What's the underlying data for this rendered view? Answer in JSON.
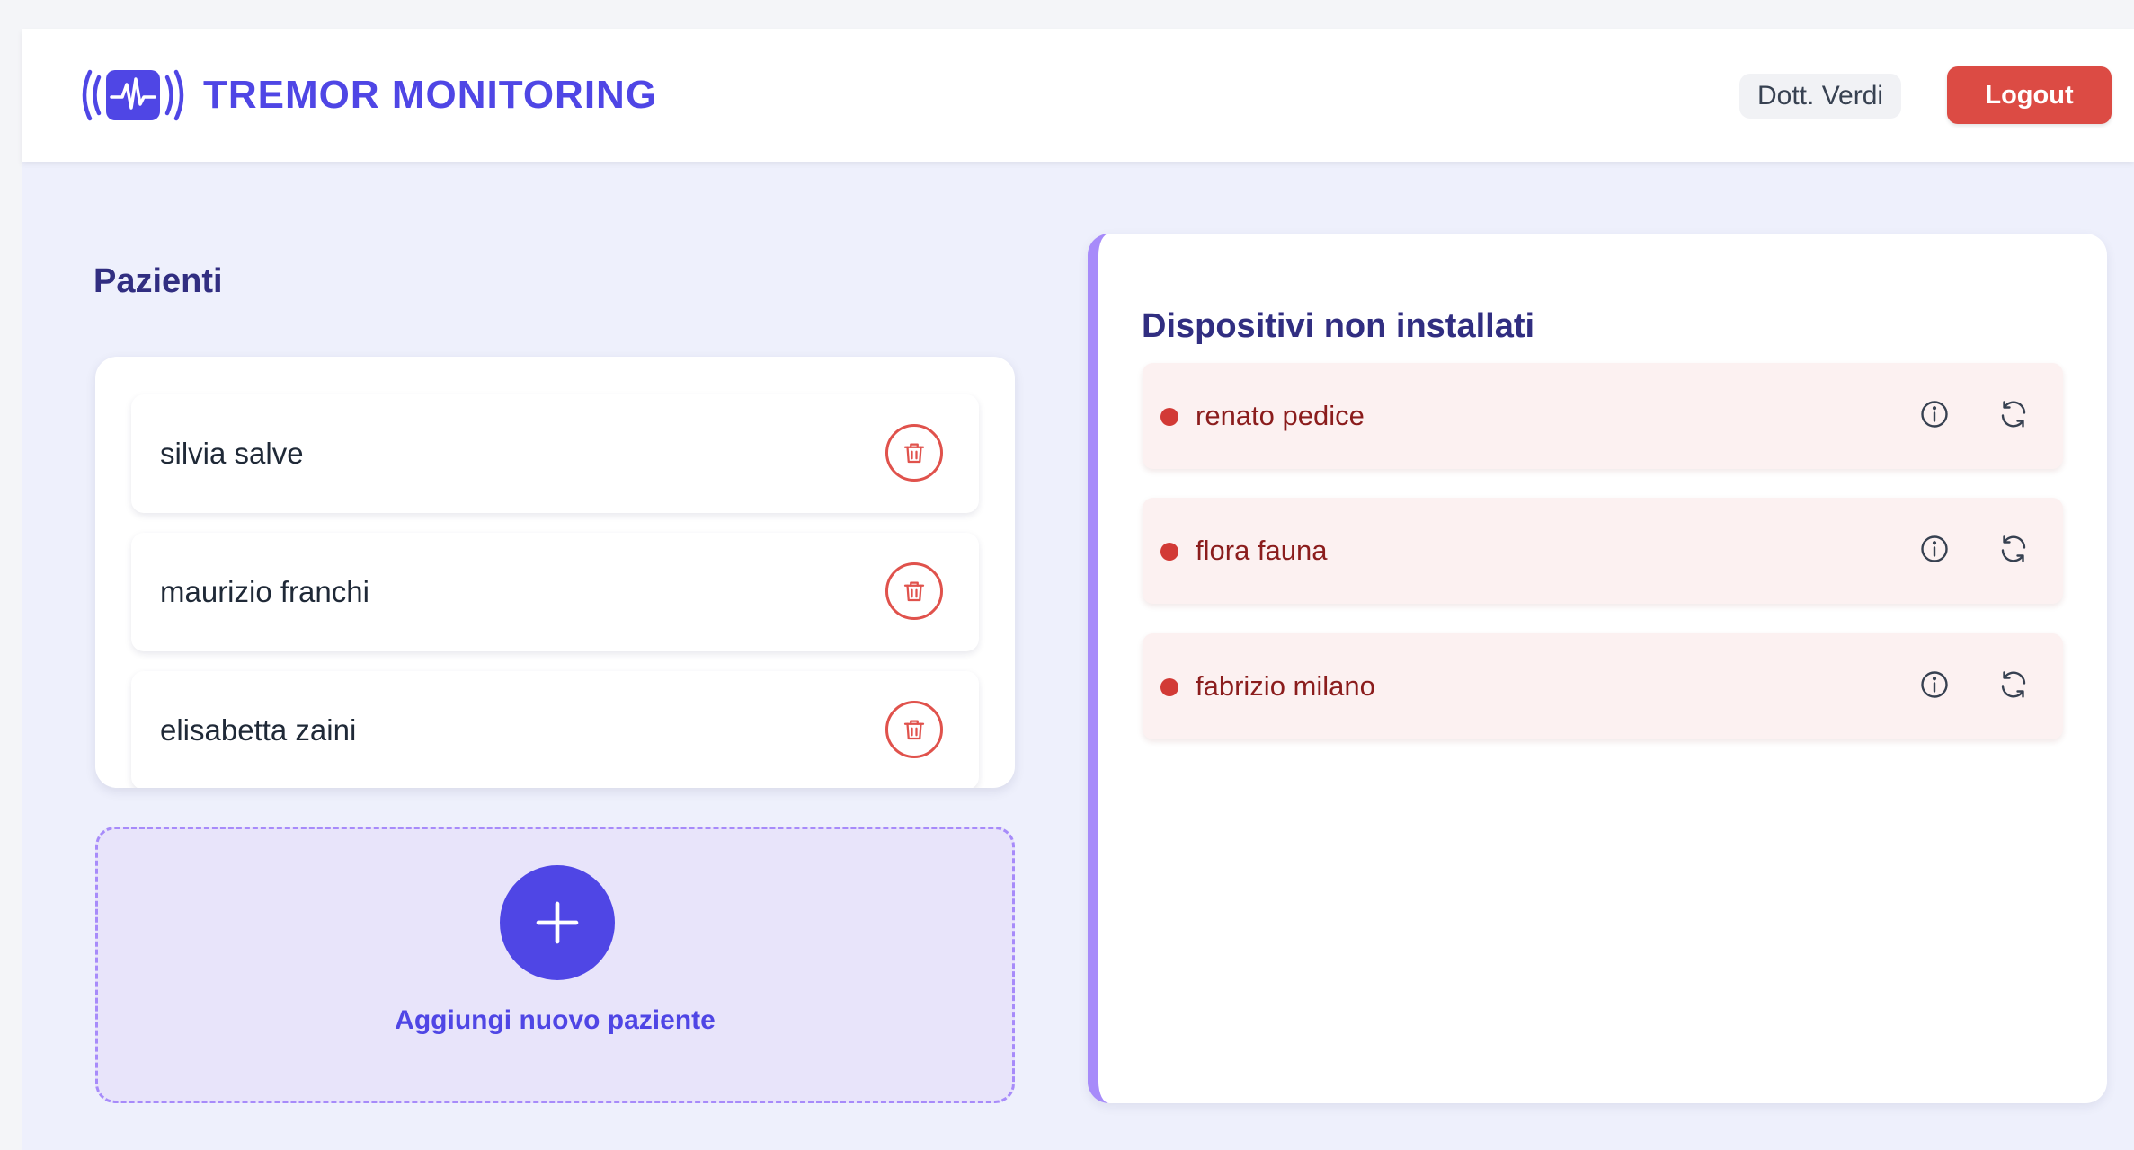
{
  "header": {
    "title": "TREMOR MONITORING",
    "logo_icon": "tremor-wave-icon",
    "user_name": "Dott. Verdi",
    "logout_label": "Logout"
  },
  "patients": {
    "section_title": "Pazienti",
    "items": [
      {
        "name": "silvia salve",
        "action_icon": "trash-icon"
      },
      {
        "name": "maurizio franchi",
        "action_icon": "trash-icon"
      },
      {
        "name": "elisabetta zaini",
        "action_icon": "trash-icon"
      }
    ],
    "add_label": "Aggiungi nuovo paziente",
    "add_icon": "plus-icon"
  },
  "devices": {
    "section_title": "Dispositivi non installati",
    "items": [
      {
        "name": "renato pedice",
        "status": "not-installed",
        "icons": [
          "info-icon",
          "refresh-icon"
        ]
      },
      {
        "name": "flora fauna",
        "status": "not-installed",
        "icons": [
          "info-icon",
          "refresh-icon"
        ]
      },
      {
        "name": "fabrizio milano",
        "status": "not-installed",
        "icons": [
          "info-icon",
          "refresh-icon"
        ]
      }
    ]
  },
  "colors": {
    "brand": "#4f46e5",
    "title": "#312e81",
    "logout": "#dc4b44",
    "danger": "#d23a36",
    "accent_border": "#a78bfa",
    "device_bg": "#fcf1f1",
    "app_bg": "#eef0fc"
  }
}
